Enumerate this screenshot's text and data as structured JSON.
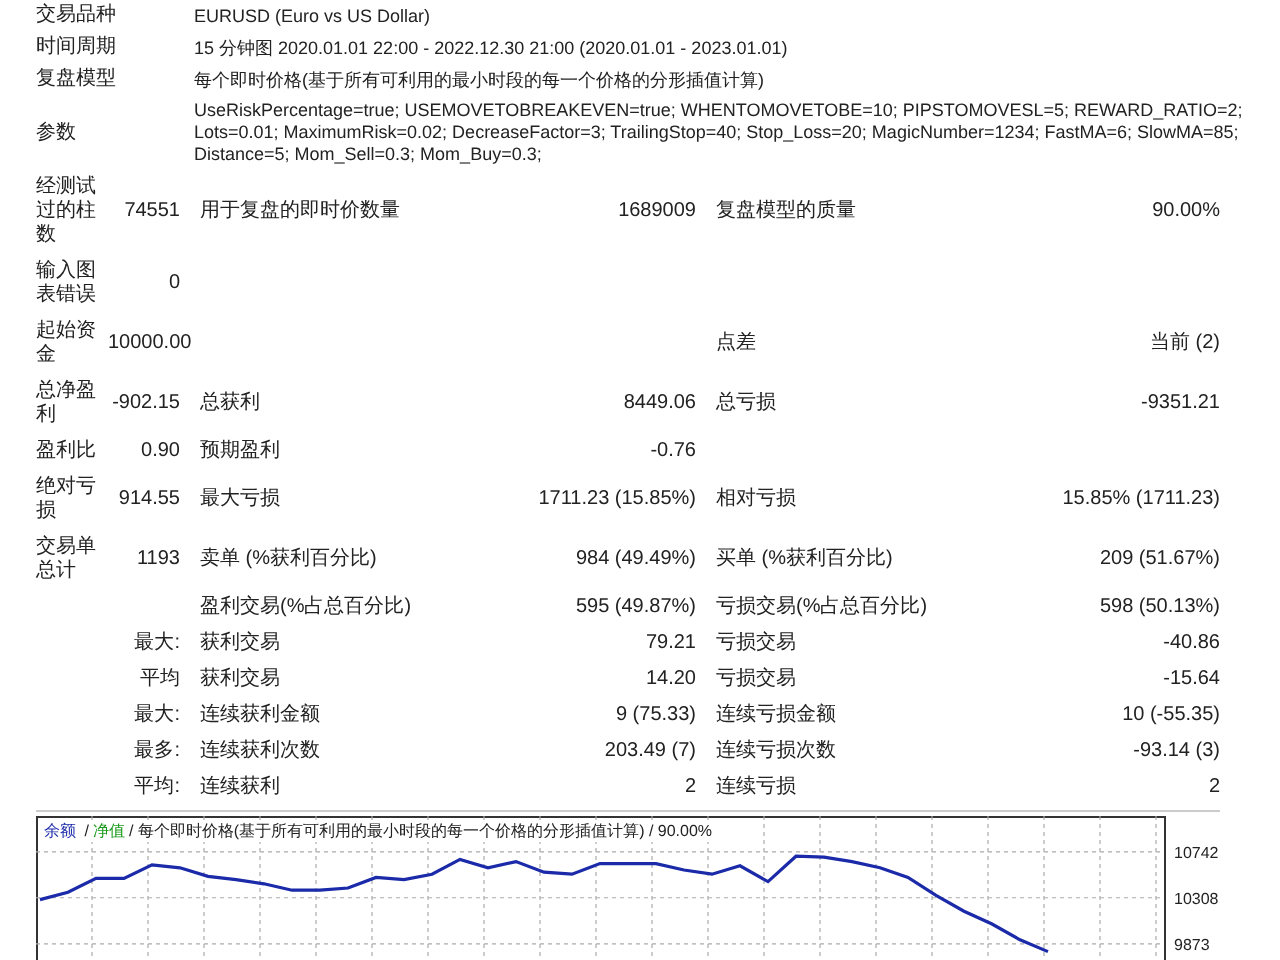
{
  "info": [
    {
      "label": "交易品种",
      "lines": [
        "EURUSD (Euro vs US Dollar)"
      ]
    },
    {
      "label": "时间周期",
      "lines": [
        "15 分钟图 2020.01.01 22:00 - 2022.12.30 21:00 (2020.01.01 - 2023.01.01)"
      ]
    },
    {
      "label": "复盘模型",
      "lines": [
        "每个即时价格(基于所有可利用的最小时段的每一个价格的分形插值计算)"
      ]
    },
    {
      "label": "参数",
      "lines": [
        "UseRiskPercentage=true; USEMOVETOBREAKEVEN=true; WHENTOMOVETOBE=10; PIPSTOMOVESL=5; REWARD_RATIO=2;",
        "Lots=0.01; MaximumRisk=0.02; DecreaseFactor=3; TrailingStop=40; Stop_Loss=20; MagicNumber=1234; FastMA=6; SlowMA=85;",
        "Distance=5; Mom_Sell=0.3; Mom_Buy=0.3;"
      ]
    }
  ],
  "stats": [
    {
      "label": "经测试过的柱数",
      "value": "74551",
      "name_2": "用于复盘的即时价数量",
      "value_2": "1689009",
      "name_3": "复盘模型的质量",
      "value_3": "90.00%"
    },
    {
      "label": "输入图表错误",
      "value": "0"
    },
    {
      "label": "起始资金",
      "value": "10000.00",
      "name_3": "点差",
      "value_3": "当前 (2)"
    },
    {
      "label": "总净盈利",
      "value": "-902.15",
      "name_2": "总获利",
      "value_2": "8449.06",
      "name_3": "总亏损",
      "value_3": "-9351.21"
    },
    {
      "label": "盈利比",
      "value": "0.90",
      "name_2": "预期盈利",
      "value_2": "-0.76"
    },
    {
      "label": "绝对亏损",
      "value": "914.55",
      "name_2": "最大亏损",
      "value_2": "1711.23 (15.85%)",
      "name_3": "相对亏损",
      "value_3": "15.85% (1711.23)"
    },
    {
      "label": "交易单总计",
      "value": "1193",
      "name_2": "卖单 (%获利百分比)",
      "value_2": "984 (49.49%)",
      "name_3": "买单 (%获利百分比)",
      "value_3": "209 (51.67%)"
    },
    {
      "name_2": "盈利交易(%占总百分比)",
      "value_2": "595 (49.87%)",
      "name_3": "亏损交易(%占总百分比)",
      "value_3": "598 (50.13%)"
    },
    {
      "value": "最大:",
      "name_2": "获利交易",
      "value_2": "79.21",
      "name_3": "亏损交易",
      "value_3": "-40.86"
    },
    {
      "value": "平均",
      "name_2": "获利交易",
      "value_2": "14.20",
      "name_3": "亏损交易",
      "value_3": "-15.64"
    },
    {
      "value": "最大:",
      "name_2": "连续获利金额",
      "value_2": "9 (75.33)",
      "name_3": "连续亏损金额",
      "value_3": "10 (-55.35)"
    },
    {
      "value": "最多:",
      "name_2": "连续获利次数",
      "value_2": "203.49 (7)",
      "name_3": "连续亏损次数",
      "value_3": "-93.14 (3)"
    },
    {
      "value": "平均:",
      "name_2": "连续获利",
      "value_2": "2",
      "name_3": "连续亏损",
      "value_3": "2"
    }
  ],
  "chart": {
    "legend": [
      {
        "text": "/"
      },
      {
        "text": "净值",
        "color": "#1a9a1a"
      },
      {
        "text": "/ 每个即时价格(基于所有可利用的最小时段的每一个价格的分形插值计算) / 90.00%"
      }
    ],
    "chart_data": {
      "type": "line",
      "ylim": [
        9720,
        11080
      ],
      "grid": true,
      "yticks": [
        10742,
        10308,
        9873
      ],
      "series": [
        {
          "name": "余额",
          "color": "#1a2aa8",
          "values": [
            10290,
            10360,
            10490,
            10490,
            10620,
            10590,
            10510,
            10480,
            10440,
            10380,
            10380,
            10400,
            10500,
            10480,
            10530,
            10670,
            10590,
            10650,
            10550,
            10530,
            10630,
            10630,
            10630,
            10570,
            10530,
            10610,
            10460,
            10700,
            10690,
            10650,
            10590,
            10500,
            10330,
            10180,
            10060,
            9910,
            9800,
            null,
            null,
            null,
            null
          ]
        }
      ]
    }
  }
}
